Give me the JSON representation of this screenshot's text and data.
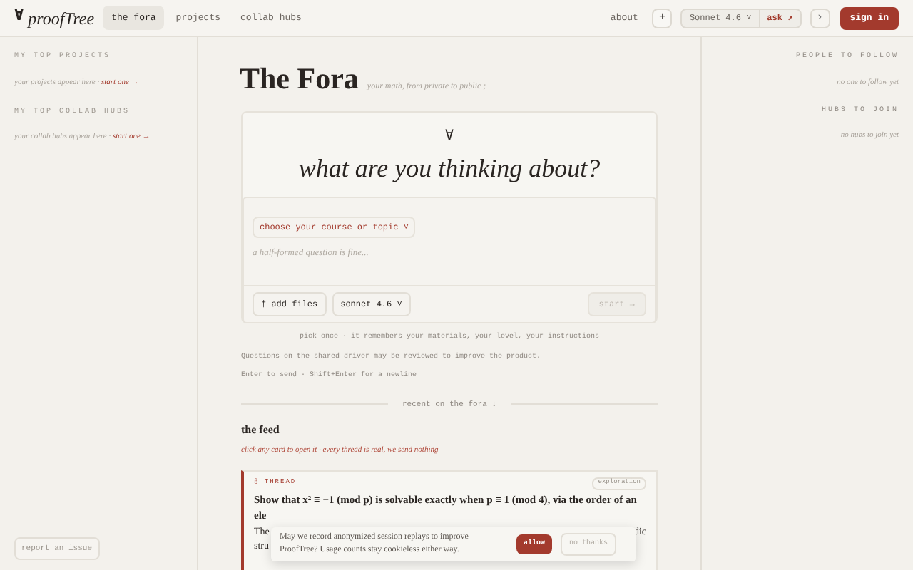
{
  "header": {
    "logo_symbol": "∀",
    "logo_text": "proofTree",
    "nav": [
      {
        "label": "the fora",
        "selected": true
      },
      {
        "label": "projects",
        "selected": false
      },
      {
        "label": "collab hubs",
        "selected": false
      }
    ],
    "about": "about",
    "plus": "+",
    "model": "Sonnet 4.6",
    "model_caret": "˅",
    "ask": "ask ↗",
    "chevron": "›",
    "sign_in": "sign in"
  },
  "left_sidebar": {
    "sections": [
      {
        "heading": "MY TOP PROJECTS",
        "empty": "your projects appear here ·",
        "link": "start one →"
      },
      {
        "heading": "MY TOP COLLAB HUBS",
        "empty": "your collab hubs appear here ·",
        "link": "start one →"
      }
    ],
    "report": "report an issue"
  },
  "right_sidebar": {
    "sections": [
      {
        "heading": "PEOPLE TO FOLLOW",
        "empty": "no one to follow yet"
      },
      {
        "heading": "HUBS TO JOIN",
        "empty": "no hubs to join yet"
      }
    ]
  },
  "main": {
    "title": "The Fora",
    "subtitle": "your math, from private to public ;",
    "hero_symbol": "∀",
    "hero_title": "what are you thinking about?",
    "composer": {
      "course": "choose your course or topic ˅",
      "placeholder": "a half-formed question is fine...",
      "add_files": "† add files",
      "model": "sonnet 4.6 ˅",
      "start": "start →",
      "start_disabled": true
    },
    "notes": [
      "pick once · it remembers your materials, your level, your instructions",
      "Questions on the shared driver may be reviewed to improve the product.",
      "Enter to send · Shift+Enter for a newline"
    ],
    "divider": "recent on the fora ↓",
    "feed_title": "the feed",
    "feed_hint": "click any card to open it · every thread is real, we send nothing",
    "threads": [
      {
        "kind": "§ THREAD",
        "tag": "exploration",
        "title": "Show that x² ≡ −1 (mod p) is solvable exactly when p ≡ 1 (mod 4), via the order of an",
        "start": "ele",
        "excerpt_start": "The",
        "excerpt_end": "dic",
        "excerpt_line2": "stru"
      }
    ]
  },
  "cookie_banner": {
    "text": "May we record anonymized session replays to improve ProofTree? Usage counts stay cookieless either way.",
    "buttons": [
      {
        "label": "allow",
        "kind": "primary"
      },
      {
        "label": "no thanks",
        "kind": "secondary"
      }
    ]
  }
}
